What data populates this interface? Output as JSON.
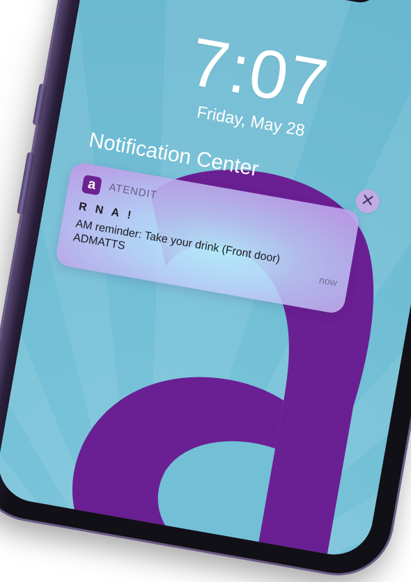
{
  "lockscreen": {
    "time": "7:07",
    "date": "Friday, May 28"
  },
  "notification_center": {
    "title": "Notification Center"
  },
  "notification": {
    "app_name": "ATENDIT",
    "app_icon_glyph": "a",
    "title": "R N A !",
    "body": "AM reminder: Take your drink (Front door) ADMATTS",
    "time": "now",
    "close_glyph": "✕"
  },
  "colors": {
    "brand_purple": "#6a238f",
    "wallpaper": "#72bfd6"
  },
  "icons": [
    "close-icon",
    "app-icon",
    "camera-icon",
    "battery-icon"
  ]
}
